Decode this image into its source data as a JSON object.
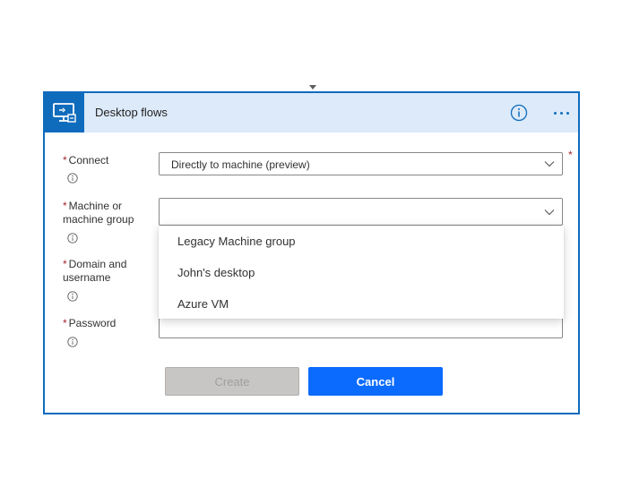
{
  "header": {
    "title": "Desktop flows",
    "app_icon": "desktop-flows-icon",
    "info_icon": "info-icon",
    "more_icon": "more-icon"
  },
  "form": {
    "required_marker": "*",
    "connect": {
      "label": "Connect",
      "value": "Directly to machine (preview)"
    },
    "machine": {
      "label_line1": "Machine or",
      "label_line2": "machine group",
      "value": ""
    },
    "domain": {
      "label_line1": "Domain and",
      "label_line2": "username",
      "value": ""
    },
    "password": {
      "label": "Password",
      "value": ""
    }
  },
  "dropdown": {
    "options": [
      "Legacy Machine group",
      "John's desktop",
      "Azure VM"
    ]
  },
  "buttons": {
    "create": "Create",
    "cancel": "Cancel"
  },
  "colors": {
    "accent": "#0f6cbd",
    "header_bg": "#dceafa",
    "required": "#a4262c",
    "primary_button": "#0b6bff",
    "disabled_button": "#c8c6c4"
  }
}
